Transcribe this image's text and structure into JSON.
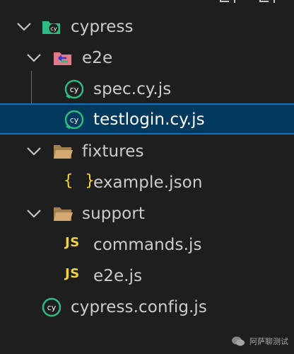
{
  "explorer": {
    "top_actions": [
      "new-file",
      "new-folder"
    ],
    "items": [
      {
        "label": "cypress",
        "kind": "folder",
        "expanded": true
      },
      {
        "label": "e2e",
        "kind": "folder",
        "expanded": true
      },
      {
        "label": "spec.cy.js",
        "kind": "cypress-file"
      },
      {
        "label": "testlogin.cy.js",
        "kind": "cypress-file",
        "selected": true
      },
      {
        "label": "fixtures",
        "kind": "folder",
        "expanded": true
      },
      {
        "label": "example.json",
        "kind": "json-file",
        "icon_text": "{ }"
      },
      {
        "label": "support",
        "kind": "folder",
        "expanded": true
      },
      {
        "label": "commands.js",
        "kind": "js-file",
        "icon_text": "JS"
      },
      {
        "label": "e2e.js",
        "kind": "js-file",
        "icon_text": "JS"
      },
      {
        "label": "cypress.config.js",
        "kind": "cypress-config-file"
      }
    ]
  },
  "colors": {
    "background": "#1e1e1e",
    "selection": "#04395e",
    "selection_border": "#0e70c0",
    "text": "#cccccc",
    "folder": "#c49a6c",
    "cypress_green": "#2fb983",
    "js_yellow": "#f0d23a"
  },
  "watermark": {
    "text": "阿萨聊测试"
  }
}
